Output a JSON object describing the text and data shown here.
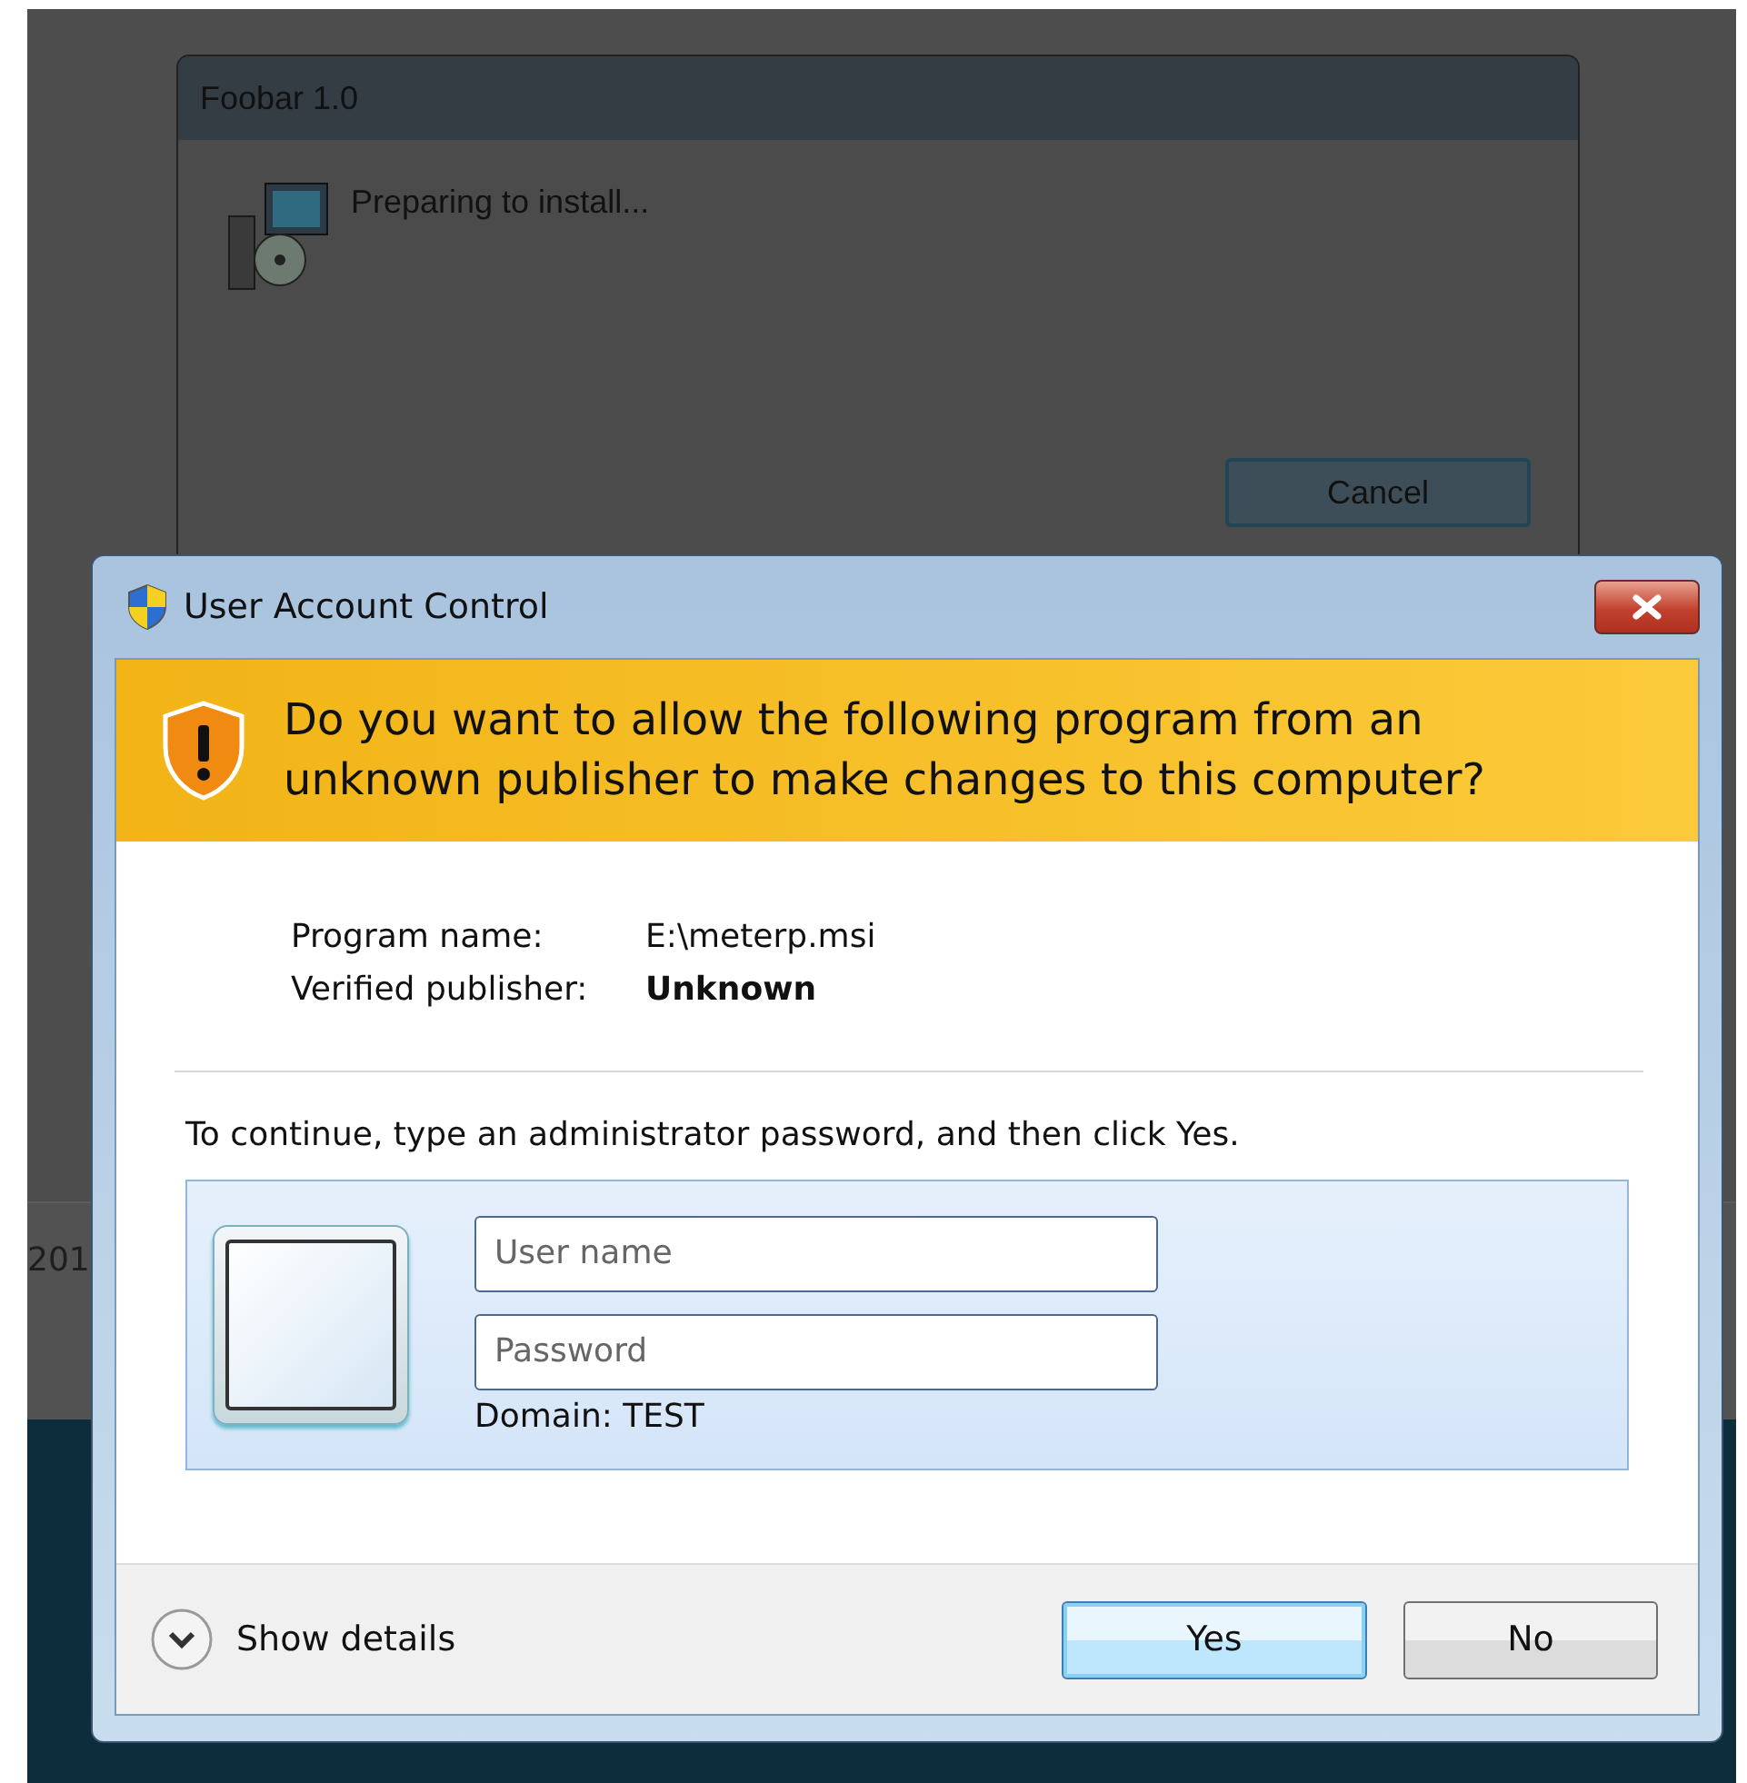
{
  "background_window": {
    "title": "Foobar 1.0",
    "message": "Preparing to install...",
    "cancel_button": "Cancel"
  },
  "background_text": "201",
  "dialog": {
    "title": "User Account Control",
    "question": "Do you want to allow the following program from an unknown publisher to make changes to this computer?",
    "details": [
      {
        "label": "Program name:",
        "value": "E:\\meterp.msi",
        "bold": false
      },
      {
        "label": "Verified publisher:",
        "value": "Unknown",
        "bold": true
      }
    ],
    "instruction": "To continue, type an administrator password, and then click Yes.",
    "user_name": {
      "placeholder": "User name"
    },
    "password": {
      "placeholder": "Password"
    },
    "domain": "Domain: TEST",
    "show_details": "Show details",
    "buttons": [
      {
        "label": "Yes",
        "default": true
      },
      {
        "label": "No",
        "default": false
      }
    ]
  }
}
